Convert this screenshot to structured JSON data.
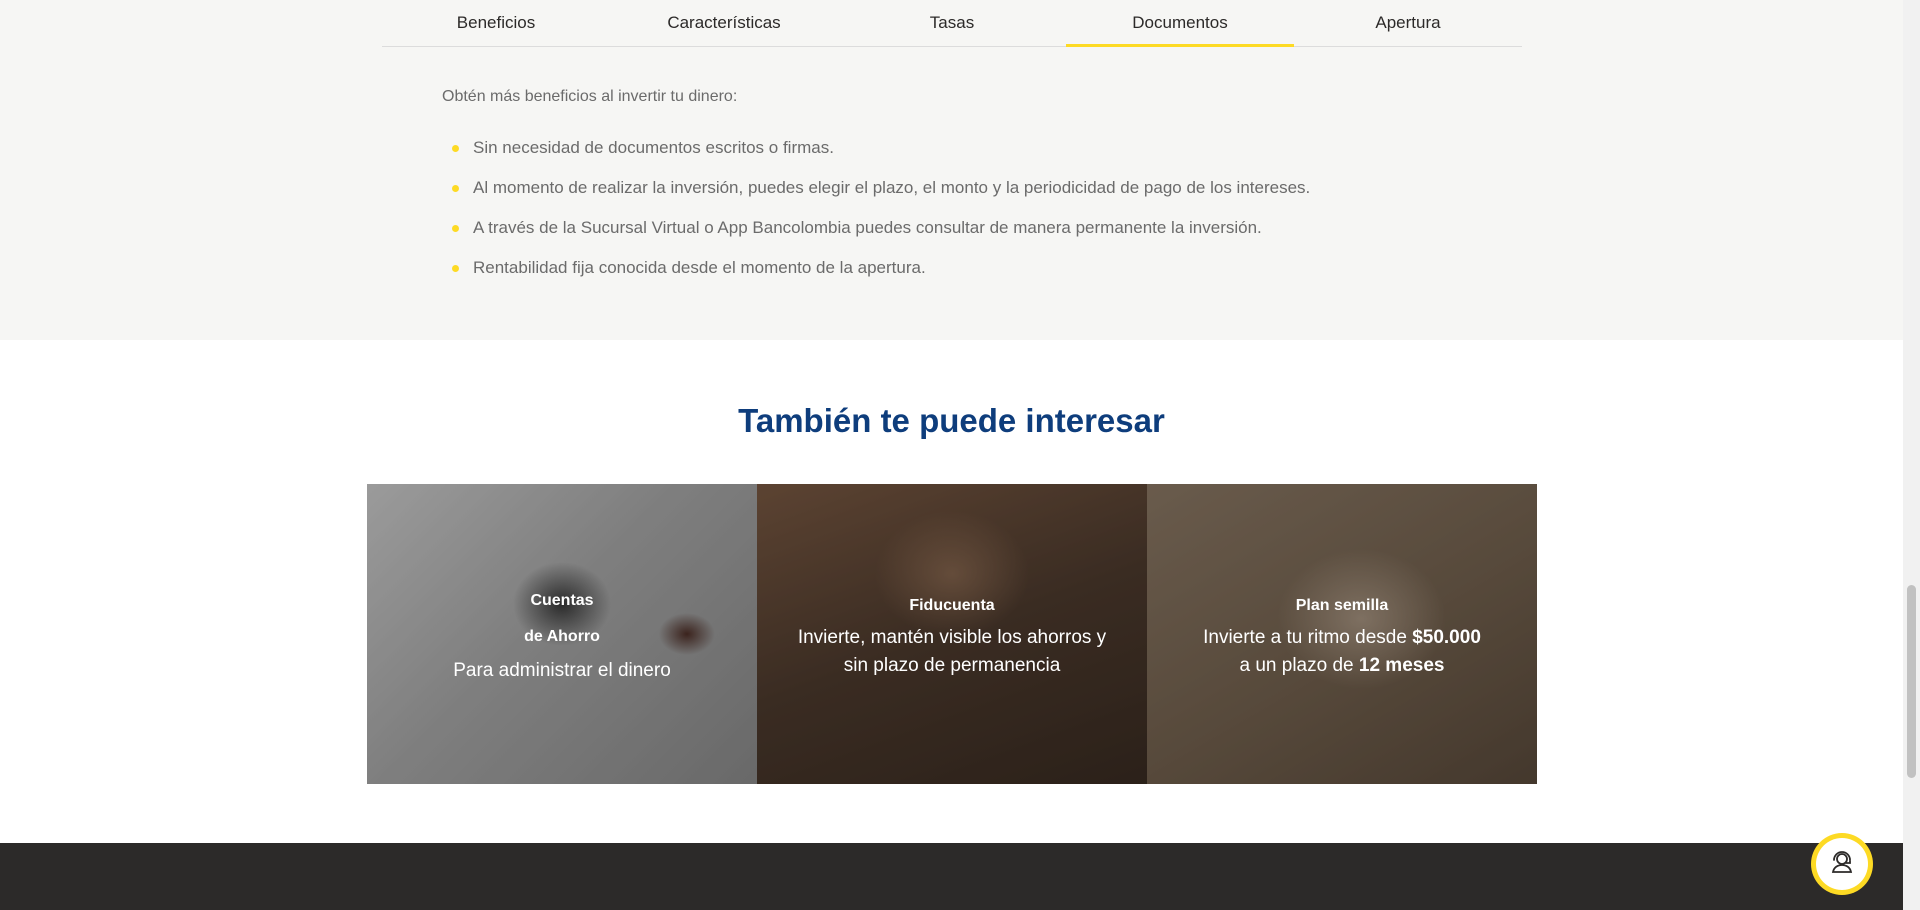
{
  "tabs": [
    {
      "label": "Beneficios"
    },
    {
      "label": "Características"
    },
    {
      "label": "Tasas"
    },
    {
      "label": "Documentos"
    },
    {
      "label": "Apertura"
    }
  ],
  "benefits": {
    "intro": "Obtén más beneficios al invertir tu dinero:",
    "items": [
      "Sin necesidad de documentos escritos o firmas.",
      "Al momento de realizar la inversión, puedes elegir el plazo, el monto y la periodicidad de pago de los intereses.",
      "A través de la Sucursal Virtual o App Bancolombia puedes consultar de manera permanente la inversión.",
      "Rentabilidad fija conocida desde el momento de la apertura."
    ]
  },
  "related": {
    "heading": "También te puede interesar",
    "cards": [
      {
        "title_line1": "Cuentas",
        "title_line2": "de Ahorro",
        "desc": "Para administrar el dinero"
      },
      {
        "title": "Fiducuenta",
        "desc_line1": "Invierte, mantén visible los ahorros y",
        "desc_line2": "sin plazo de permanencia"
      },
      {
        "title": "Plan semilla",
        "desc_pre": "Invierte a tu ritmo desde ",
        "desc_amount": "$50.000",
        "desc_mid": "a un plazo de ",
        "desc_term": "12 meses"
      }
    ]
  },
  "colors": {
    "accent": "#fdda24",
    "heading": "#0e3d7c",
    "footer": "#2c2a29"
  },
  "help_button": {
    "icon": "support-agent-icon"
  }
}
